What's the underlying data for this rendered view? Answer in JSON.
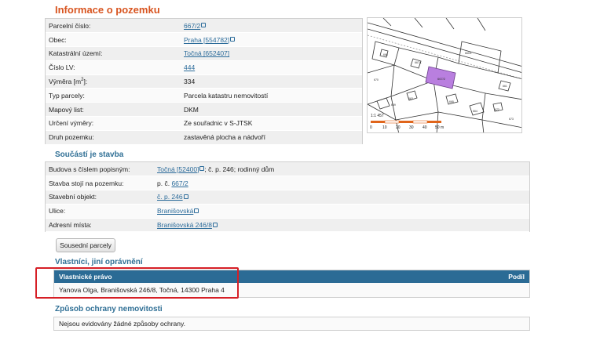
{
  "parcel_info": {
    "title": "Informace o pozemku",
    "rows": [
      {
        "label": "Parcelní číslo:",
        "value": "667/2",
        "link": true
      },
      {
        "label": "Obec:",
        "value": "Praha [554782]",
        "link": true
      },
      {
        "label": "Katastrální území:",
        "value": "Točná [652407]",
        "link": true
      },
      {
        "label": "Číslo LV:",
        "value": "444",
        "link": true
      },
      {
        "label_main": "Výměra [m",
        "label_sup": "2",
        "label_end": "]:",
        "value": "334",
        "link": false
      },
      {
        "label": "Typ parcely:",
        "value": "Parcela katastru nemovitostí",
        "link": false
      },
      {
        "label": "Mapový list:",
        "value": "DKM",
        "link": false
      },
      {
        "label": "Určení výměry:",
        "value": "Ze souřadnic v S-JTSK",
        "link": false
      },
      {
        "label": "Druh pozemku:",
        "value": "zastavěná plocha a nádvoří",
        "link": false
      }
    ]
  },
  "map": {
    "scale_label": "1:1 457",
    "scale_ticks": [
      "0",
      "10",
      "20",
      "30",
      "40",
      "50 m"
    ],
    "parcel_label": "667/2",
    "labels": [
      "667/1",
      "668",
      "669",
      "660/1",
      "663",
      "665",
      "664",
      "661",
      "670",
      "672",
      "673"
    ],
    "colors": {
      "parcel": "#b97fdf",
      "scale_bar": "#e0651b",
      "line": "#333333"
    }
  },
  "building": {
    "title": "Součástí je stavba",
    "rows": [
      {
        "label": "Budova s číslem popisným:",
        "link_text": "Točná [52400]",
        "suffix": "; č. p. 246; rodinný dům"
      },
      {
        "label": "Stavba stojí na pozemku:",
        "prefix": "p. č. ",
        "link_text": "667/2"
      },
      {
        "label": "Stavební objekt:",
        "link_text": "č. p. 246"
      },
      {
        "label": "Ulice:",
        "link_text": "Branišovská"
      },
      {
        "label": "Adresní místa:",
        "link_text": "Branišovská 246/8"
      }
    ]
  },
  "neighbors_button": "Sousední parcely",
  "ownership": {
    "title": "Vlastníci, jiní oprávnění",
    "col_right": "Podíl",
    "col_left": "Vlastnické právo",
    "owner": "Yanova Olga, Branišovská 246/8, Točná, 14300 Praha 4"
  },
  "protection": {
    "title": "Způsob ochrany nemovitosti",
    "text": "Nejsou evidovány žádné způsoby ochrany."
  }
}
